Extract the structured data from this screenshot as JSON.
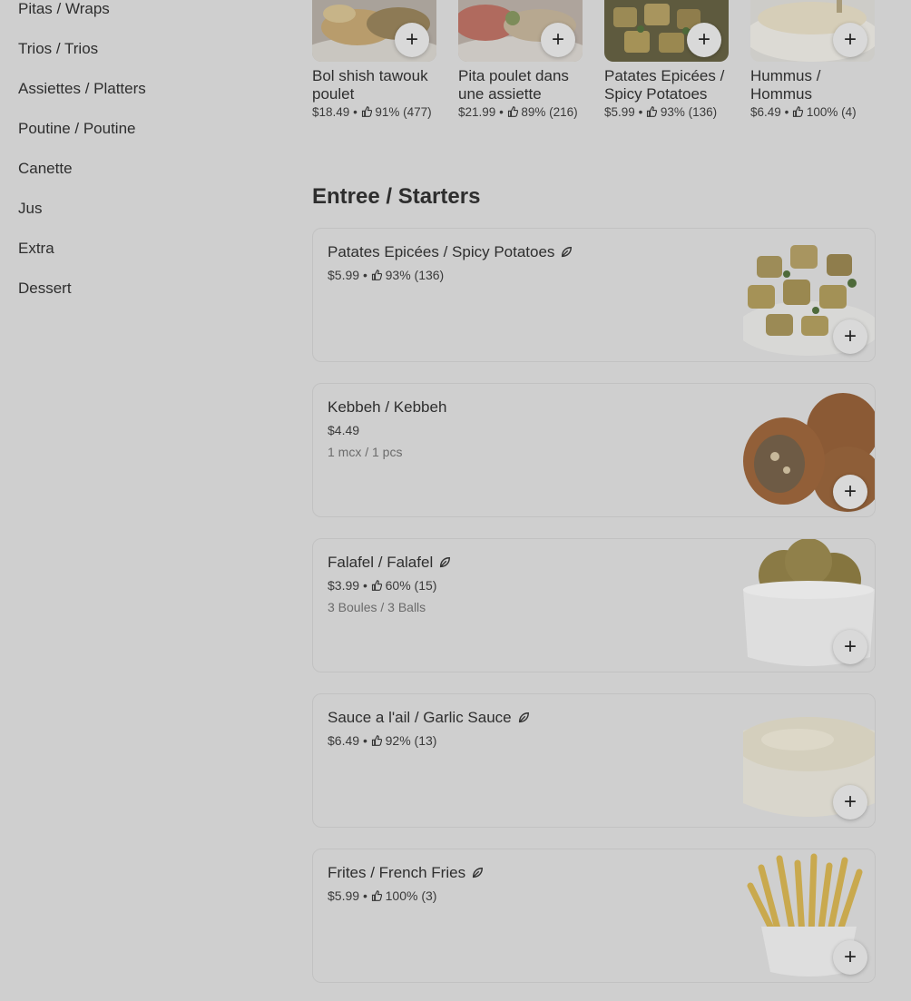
{
  "sidebar": {
    "items": [
      {
        "label": "Pitas / Wraps"
      },
      {
        "label": "Trios / Trios"
      },
      {
        "label": "Assiettes / Platters"
      },
      {
        "label": "Poutine / Poutine"
      },
      {
        "label": "Canette"
      },
      {
        "label": "Jus"
      },
      {
        "label": "Extra"
      },
      {
        "label": "Dessert"
      }
    ]
  },
  "popular": [
    {
      "name": "Bol shish tawouk poulet",
      "price": "$18.49",
      "rating": "91% (477)",
      "image": "bowl-dish"
    },
    {
      "name": "Pita poulet dans une assiette",
      "price": "$21.99",
      "rating": "89% (216)",
      "image": "plate-dish"
    },
    {
      "name": "Patates Epicées / Spicy Potatoes",
      "price": "$5.99",
      "rating": "93% (136)",
      "image": "potatoes"
    },
    {
      "name": "Hummus / Hommus",
      "price": "$6.49",
      "rating": "100% (4)",
      "image": "hummus"
    }
  ],
  "section": {
    "title": "Entree / Starters"
  },
  "items": [
    {
      "name": "Patates Epicées / Spicy Potatoes",
      "price": "$5.99",
      "rating": "93% (136)",
      "desc": "",
      "veg": true,
      "image": "potatoes"
    },
    {
      "name": "Kebbeh / Kebbeh",
      "price": "$4.49",
      "rating": "",
      "desc": "1 mcx / 1 pcs",
      "veg": false,
      "image": "kebbeh"
    },
    {
      "name": "Falafel / Falafel",
      "price": "$3.99",
      "rating": "60% (15)",
      "desc": "3 Boules / 3 Balls",
      "veg": true,
      "image": "falafel"
    },
    {
      "name": "Sauce a l'ail / Garlic Sauce",
      "price": "$6.49",
      "rating": "92% (13)",
      "desc": "",
      "veg": true,
      "image": "garlic-sauce"
    },
    {
      "name": "Frites / French Fries",
      "price": "$5.99",
      "rating": "100% (3)",
      "desc": "",
      "veg": true,
      "image": "fries"
    }
  ],
  "icons": {
    "add": "plus-icon",
    "rating": "thumbs-up-icon",
    "veg": "leaf-icon"
  },
  "separator": "•",
  "add_symbol": "+"
}
